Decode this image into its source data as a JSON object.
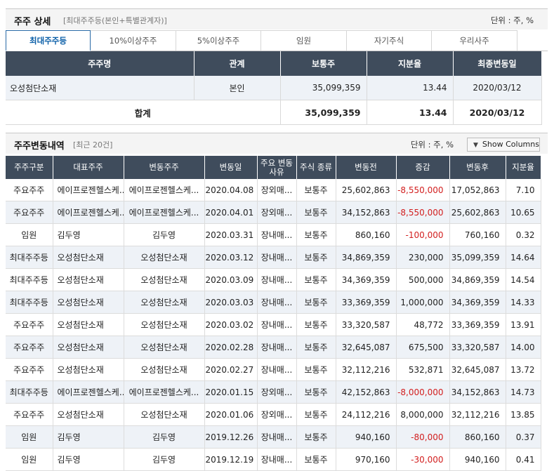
{
  "section1": {
    "title": "주주 상세",
    "subtitle": "[최대주주등(본인+특별관계자)]",
    "unit": "단위 : 주, %",
    "tabs": [
      "최대주주등",
      "10%이상주주",
      "5%이상주주",
      "임원",
      "자기주식",
      "우리사주"
    ],
    "headers": [
      "주주명",
      "관계",
      "보통주",
      "지분율",
      "최종변동일"
    ],
    "rows": [
      {
        "name": "오성첨단소재",
        "relation": "본인",
        "shares": "35,099,359",
        "ratio": "13.44",
        "date": "2020/03/12"
      }
    ],
    "total": {
      "label": "합계",
      "shares": "35,099,359",
      "ratio": "13.44",
      "date": "2020/03/12"
    }
  },
  "section2": {
    "title": "주주변동내역",
    "subtitle": "[최근 20건]",
    "unit": "단위 : 주, %",
    "show_columns": "Show Columns",
    "headers": [
      "주주구분",
      "대표주주",
      "변동주주",
      "변동일",
      "주요 변동사유",
      "주식 종류",
      "변동전",
      "증감",
      "변동후",
      "지분율"
    ],
    "rows": [
      [
        "주요주주",
        "에이프로젠헬스케...",
        "에이프로젠헬스케...",
        "2020.04.08",
        "장외매...",
        "보통주",
        "25,602,863",
        "-8,550,000",
        "17,052,863",
        "7.10"
      ],
      [
        "주요주주",
        "에이프로젠헬스케...",
        "에이프로젠헬스케...",
        "2020.04.01",
        "장외매...",
        "보통주",
        "34,152,863",
        "-8,550,000",
        "25,602,863",
        "10.65"
      ],
      [
        "임원",
        "김두영",
        "김두영",
        "2020.03.31",
        "장내매...",
        "보통주",
        "860,160",
        "-100,000",
        "760,160",
        "0.32"
      ],
      [
        "최대주주등",
        "오성첨단소재",
        "오성첨단소재",
        "2020.03.12",
        "장내매...",
        "보통주",
        "34,869,359",
        "230,000",
        "35,099,359",
        "14.64"
      ],
      [
        "최대주주등",
        "오성첨단소재",
        "오성첨단소재",
        "2020.03.09",
        "장내매...",
        "보통주",
        "34,369,359",
        "500,000",
        "34,869,359",
        "14.54"
      ],
      [
        "최대주주등",
        "오성첨단소재",
        "오성첨단소재",
        "2020.03.03",
        "장내매...",
        "보통주",
        "33,369,359",
        "1,000,000",
        "34,369,359",
        "14.33"
      ],
      [
        "주요주주",
        "오성첨단소재",
        "오성첨단소재",
        "2020.03.02",
        "장내매...",
        "보통주",
        "33,320,587",
        "48,772",
        "33,369,359",
        "13.91"
      ],
      [
        "주요주주",
        "오성첨단소재",
        "오성첨단소재",
        "2020.02.28",
        "장내매...",
        "보통주",
        "32,645,087",
        "675,500",
        "33,320,587",
        "14.00"
      ],
      [
        "주요주주",
        "오성첨단소재",
        "오성첨단소재",
        "2020.02.27",
        "장내매...",
        "보통주",
        "32,112,216",
        "532,871",
        "32,645,087",
        "13.72"
      ],
      [
        "최대주주등",
        "에이프로젠헬스케...",
        "에이프로젠헬스케...",
        "2020.01.15",
        "장외매...",
        "보통주",
        "42,152,863",
        "-8,000,000",
        "34,152,863",
        "14.73"
      ],
      [
        "주요주주",
        "오성첨단소재",
        "오성첨단소재",
        "2020.01.06",
        "장외매...",
        "보통주",
        "24,112,216",
        "8,000,000",
        "32,112,216",
        "13.85"
      ],
      [
        "임원",
        "김두영",
        "김두영",
        "2019.12.26",
        "장내매...",
        "보통주",
        "940,160",
        "-80,000",
        "860,160",
        "0.37"
      ],
      [
        "임원",
        "김두영",
        "김두영",
        "2019.12.19",
        "장내매...",
        "보통주",
        "970,160",
        "-30,000",
        "940,160",
        "0.41"
      ]
    ]
  },
  "colors": {
    "header_bg": "#3f4c5c",
    "negative": "#d21e1e",
    "tab_active": "#0b5fa8",
    "row_alt": "#eef2f7"
  }
}
